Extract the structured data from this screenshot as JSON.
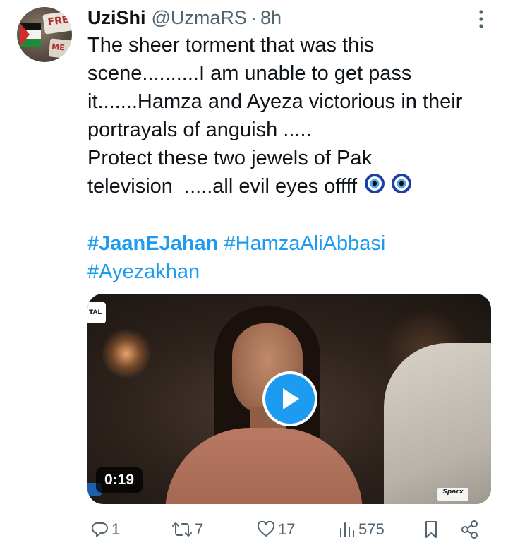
{
  "tweet": {
    "author": {
      "display_name": "UziShi",
      "handle": "@UzmaRS",
      "separator": "·",
      "time": "8h"
    },
    "text": "The sheer torment that was this\nscene..........I am unable to get pass\nit.......Hamza and Ayeza victorious in their\nportrayals of anguish .....\nProtect these two jewels of Pak\ntelevision  .....all evil eyes offff",
    "hashtags": {
      "first": "#JaanEJahan",
      "second": "#HamzaAliAbbasi",
      "third": "#Ayezakhan"
    },
    "media": {
      "duration": "0:19",
      "watermark": "Sparx",
      "channel_logo": "TAL"
    },
    "actions": {
      "replies": "1",
      "reposts": "7",
      "likes": "17",
      "views": "575"
    },
    "icons": {
      "more": "more-options-icon",
      "reply": "reply-icon",
      "repost": "repost-icon",
      "like": "heart-icon",
      "views": "views-icon",
      "bookmark": "bookmark-icon",
      "share": "share-icon",
      "emoji": "nazar-amulet-emoji"
    },
    "colors": {
      "accent": "#1d9bf0",
      "text": "#0f1419",
      "secondary": "#536471"
    }
  }
}
